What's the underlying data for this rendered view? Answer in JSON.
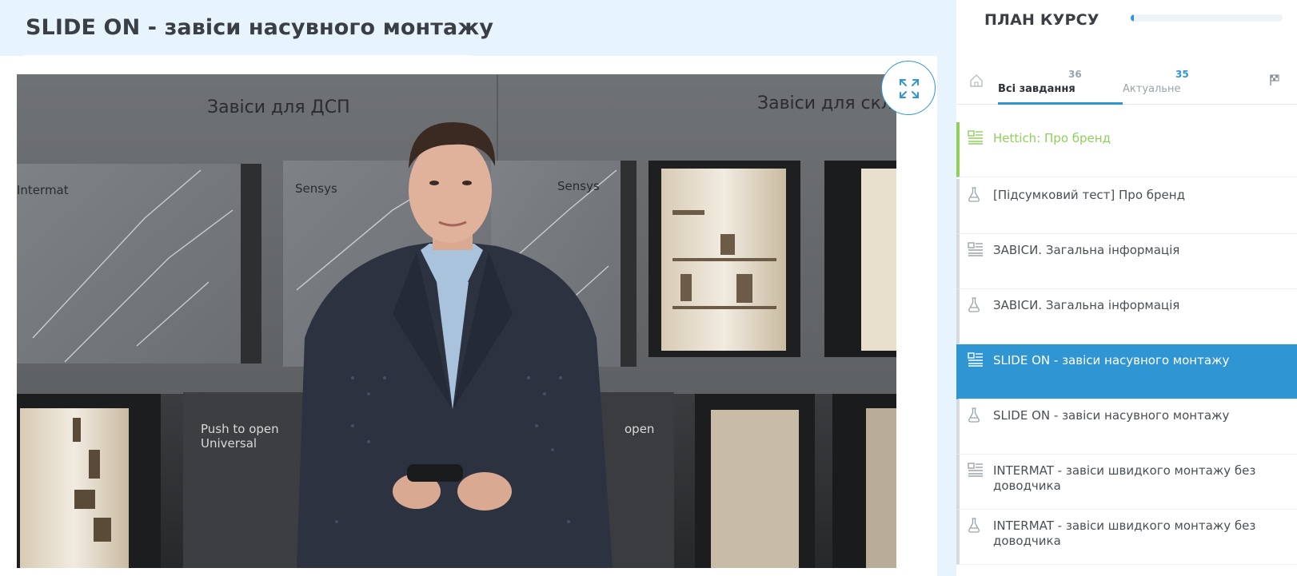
{
  "page_title": "SLIDE ON - завіси насувного монтажу",
  "video": {
    "scene_texts": [
      "Завіси для ДСП",
      "Завіси для скла",
      "Intermat",
      "Sensys",
      "Sensys",
      "Push to open",
      "Universal",
      "open"
    ]
  },
  "sidebar": {
    "plan_title": "ПЛАН КУРСУ",
    "progress_fraction": 0.02,
    "tabs": {
      "all_label": "Всі завдання",
      "all_count": "36",
      "actual_label": "Актуальне",
      "actual_count": "35"
    },
    "items": [
      {
        "label": "Hettich: Про бренд",
        "icon": "lesson-icon",
        "state": "done"
      },
      {
        "label": "[Підсумковий тест] Про бренд",
        "icon": "test-flask-icon",
        "state": "normal"
      },
      {
        "label": "ЗАВІСИ. Загальна інформація",
        "icon": "lesson-icon",
        "state": "normal"
      },
      {
        "label": "ЗАВІСИ. Загальна інформація",
        "icon": "test-flask-icon",
        "state": "normal"
      },
      {
        "label": "SLIDE ON - завіси насувного монтажу",
        "icon": "lesson-icon",
        "state": "active"
      },
      {
        "label": "SLIDE ON - завіси насувного монтажу",
        "icon": "test-flask-icon",
        "state": "normal"
      },
      {
        "label": "INTERMAT - завіси швидкого монтажу без доводчика",
        "icon": "lesson-icon",
        "state": "normal"
      },
      {
        "label": "INTERMAT - завіси швидкого монтажу без доводчика",
        "icon": "test-flask-icon",
        "state": "normal"
      }
    ]
  },
  "colors": {
    "accent": "#2f95d3",
    "done": "#8fcf5a",
    "title_bg": "#e8f4fd"
  }
}
